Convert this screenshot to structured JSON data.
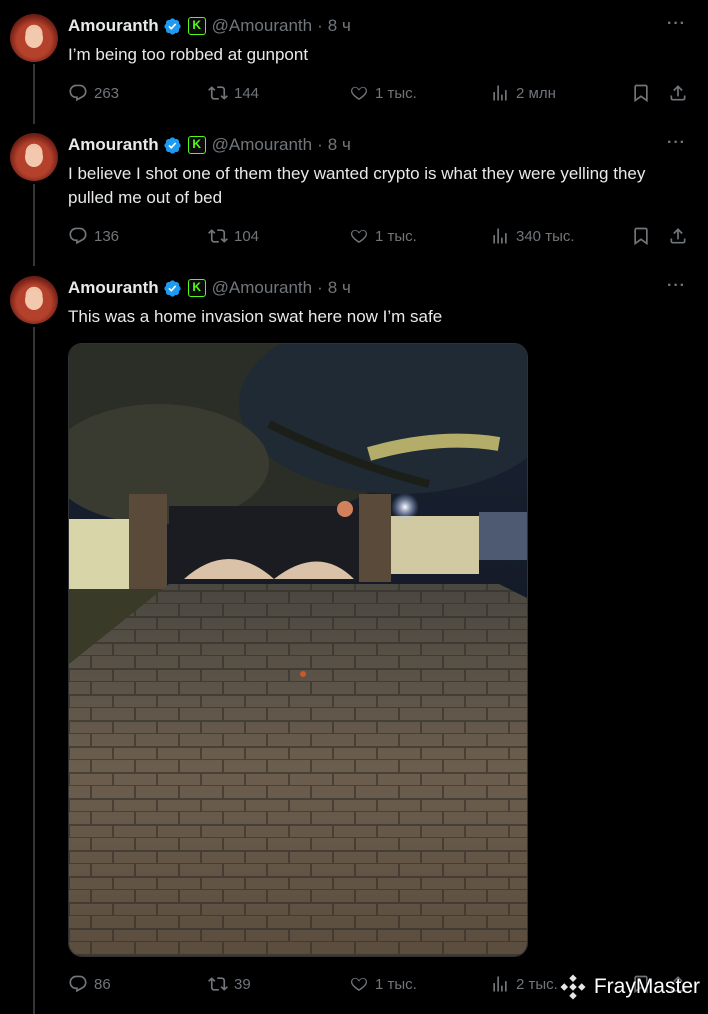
{
  "colors": {
    "background": "#000000",
    "text": "#e7e9ea",
    "muted": "#71767b",
    "verified": "#1d9bf0",
    "kick": "#53fc18"
  },
  "tweets": [
    {
      "name": "Amouranth",
      "handle": "@Amouranth",
      "dot": "·",
      "time": "8 ч",
      "more": "···",
      "text": "I’m being too robbed at gunpont",
      "replies": "263",
      "retweets": "144",
      "likes": "1 тыс.",
      "views": "2 млн"
    },
    {
      "name": "Amouranth",
      "handle": "@Amouranth",
      "dot": "·",
      "time": "8 ч",
      "more": "···",
      "text": "I believe I shot one of them they wanted crypto is what they were yelling they pulled me out of bed",
      "replies": "136",
      "retweets": "104",
      "likes": "1 тыс.",
      "views": "340 тыс."
    },
    {
      "name": "Amouranth",
      "handle": "@Amouranth",
      "dot": "·",
      "time": "8 ч",
      "more": "···",
      "text": "This was a home invasion swat here now I’m safe",
      "replies": "86",
      "retweets": "39",
      "likes": "1 тыс.",
      "views": "2 тыс."
    }
  ],
  "icons": {
    "reply": "reply-icon",
    "retweet": "retweet-icon",
    "like": "heart-icon",
    "views": "views-icon",
    "bookmark": "bookmark-icon",
    "share": "share-icon",
    "verified": "verified-badge-icon",
    "kick": "kick-logo-icon",
    "kick_letter": "K"
  },
  "watermark": {
    "text": "FrayMaster"
  }
}
